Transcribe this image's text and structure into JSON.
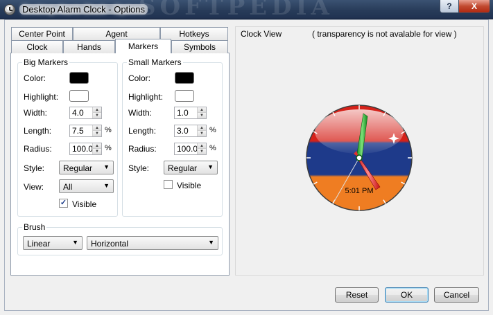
{
  "window": {
    "title": "Desktop Alarm Clock - Options",
    "help_label": "?",
    "close_label": "X"
  },
  "tabs": {
    "row_top": [
      {
        "label": "Center Point"
      },
      {
        "label": "Agent"
      },
      {
        "label": "Hotkeys"
      }
    ],
    "row_bottom": [
      {
        "label": "Clock"
      },
      {
        "label": "Hands"
      },
      {
        "label": "Markers",
        "active": true
      },
      {
        "label": "Symbols"
      }
    ]
  },
  "big_markers": {
    "title": "Big Markers",
    "color_label": "Color:",
    "color_value": "#000000",
    "highlight_label": "Highlight:",
    "highlight_value": "#ffffff",
    "width_label": "Width:",
    "width_value": "4.0",
    "length_label": "Length:",
    "length_value": "7.5",
    "length_unit": "%",
    "radius_label": "Radius:",
    "radius_value": "100.0",
    "radius_unit": "%",
    "style_label": "Style:",
    "style_value": "Regular",
    "view_label": "View:",
    "view_value": "All",
    "visible_label": "Visible",
    "visible_checked": true
  },
  "small_markers": {
    "title": "Small Markers",
    "color_label": "Color:",
    "color_value": "#000000",
    "highlight_label": "Highlight:",
    "highlight_value": "#ffffff",
    "width_label": "Width:",
    "width_value": "1.0",
    "length_label": "Length:",
    "length_value": "3.0",
    "length_unit": "%",
    "radius_label": "Radius:",
    "radius_value": "100.0",
    "radius_unit": "%",
    "style_label": "Style:",
    "style_value": "Regular",
    "visible_label": "Visible",
    "visible_checked": false
  },
  "brush": {
    "title": "Brush",
    "type_value": "Linear",
    "direction_value": "Horizontal"
  },
  "clock_view": {
    "title": "Clock View",
    "note": "( transparency is not avalable for view )",
    "time_text": "5:01 PM",
    "face_colors": {
      "top": "#d5221a",
      "middle": "#1e3a8a",
      "bottom": "#ef7d22"
    }
  },
  "buttons": {
    "reset_label": "Reset",
    "ok_label": "OK",
    "cancel_label": "Cancel"
  }
}
